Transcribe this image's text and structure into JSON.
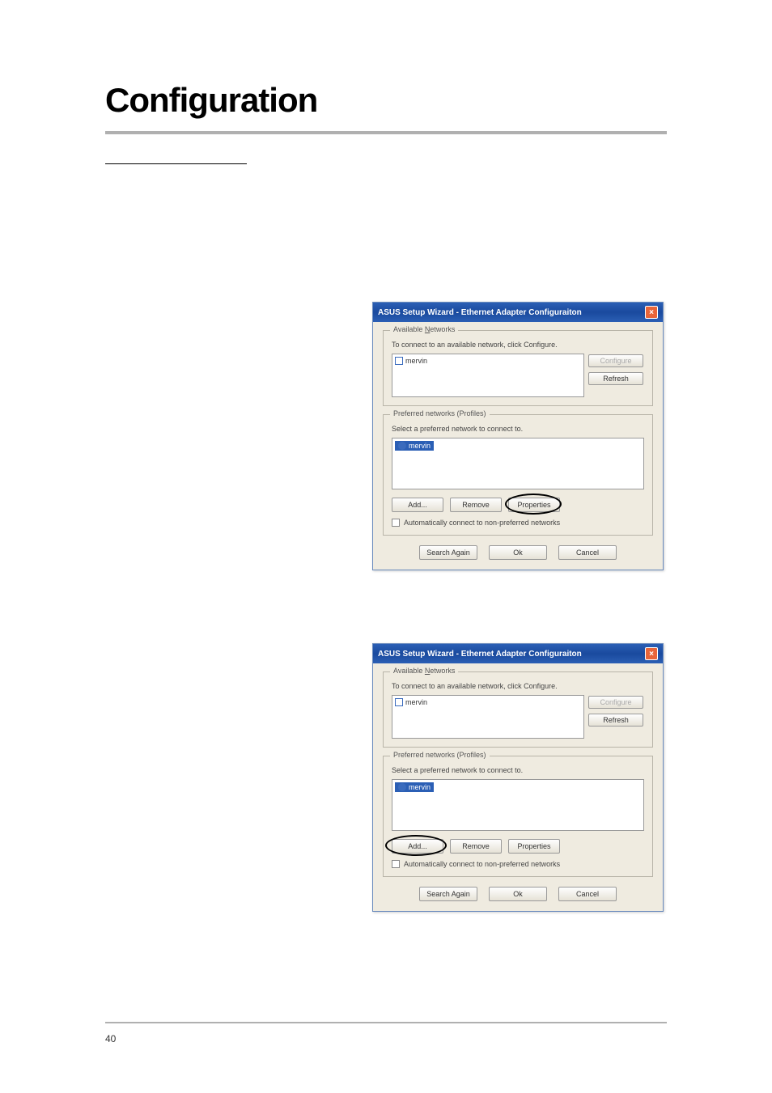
{
  "page": {
    "heading": "Configuration",
    "page_number": "40"
  },
  "window": {
    "title": "ASUS Setup Wizard - Ethernet Adapter Configuraiton",
    "available": {
      "group_label_pre": "Available ",
      "group_label_u": "N",
      "group_label_post": "etworks",
      "desc": "To connect to an available network, click Configure.",
      "item_label": "mervin",
      "configure_btn": "Configure",
      "refresh_btn": "Refresh"
    },
    "preferred": {
      "group_label": "Preferred networks (Profiles)",
      "desc": "Select a preferred network to connect to.",
      "item_label": "mervin",
      "add_btn": "Add...",
      "remove_btn": "Remove",
      "properties_btn": "Properties",
      "checkbox_label": "Automatically connect to non-preferred networks"
    },
    "bottom": {
      "search_again": "Search Again",
      "ok": "Ok",
      "cancel": "Cancel"
    }
  }
}
